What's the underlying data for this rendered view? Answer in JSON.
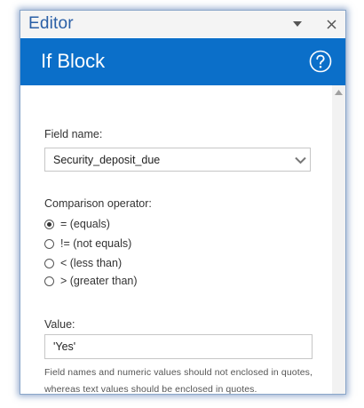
{
  "pane": {
    "title": "Editor",
    "dropdown_icon": "chevron-down-icon",
    "close_icon": "close-icon"
  },
  "header": {
    "title": "If Block",
    "help_icon": "help-circle-icon",
    "color": "#0b6fc9"
  },
  "form": {
    "field_name_label": "Field name:",
    "field_name_value": "Security_deposit_due",
    "operator_label": "Comparison operator:",
    "operators": [
      {
        "label": "= (equals)",
        "selected": true
      },
      {
        "label": "!= (not equals)",
        "selected": false
      },
      {
        "label": "< (less than)",
        "selected": false
      },
      {
        "label": "> (greater than)",
        "selected": false
      }
    ],
    "value_label": "Value:",
    "value": "'Yes'",
    "help_text": "Field names and numeric values should not enclosed in quotes, whereas text values should be enclosed in quotes."
  }
}
